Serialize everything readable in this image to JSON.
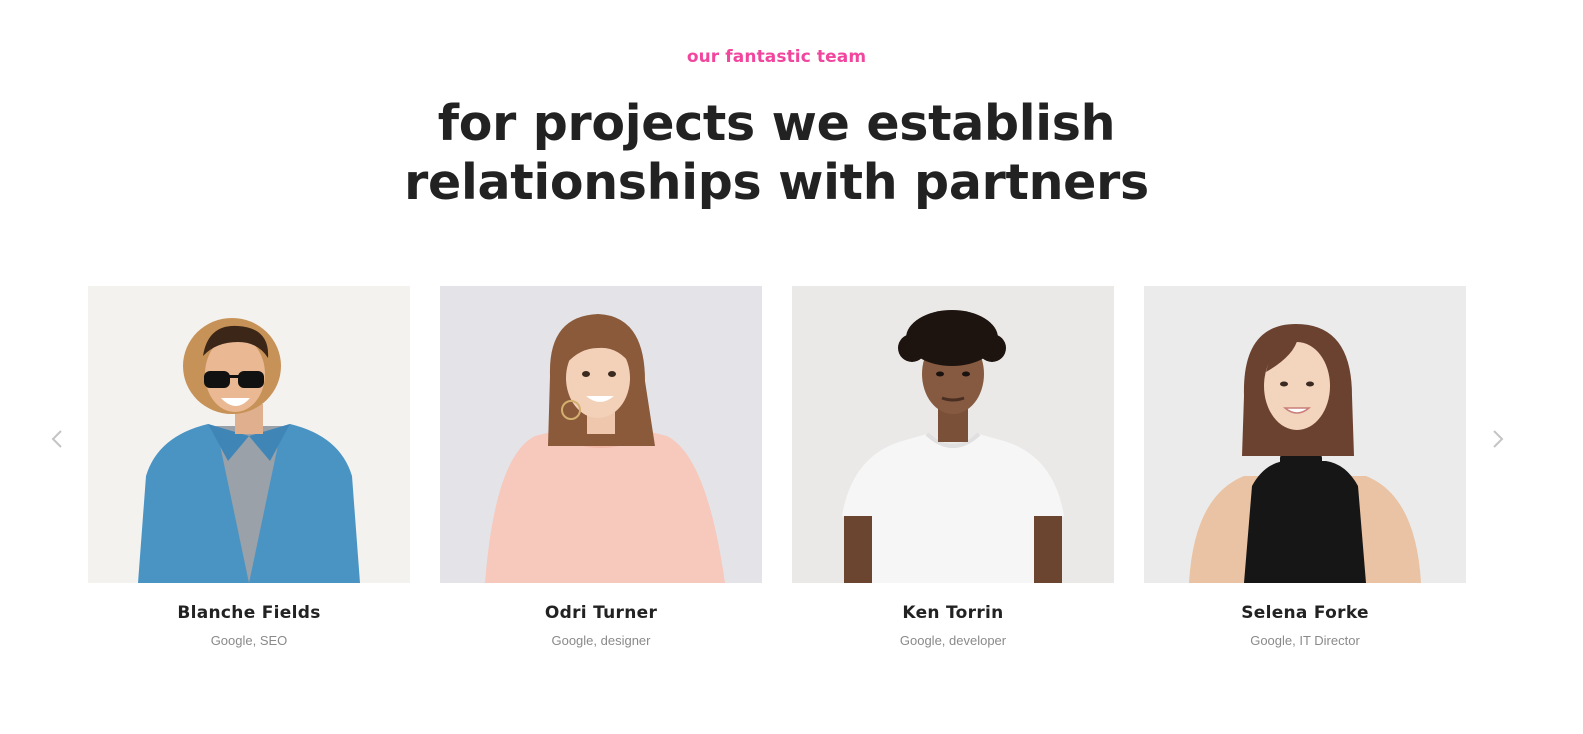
{
  "section": {
    "eyebrow": "our fantastic team",
    "headline_line1": "for projects we establish",
    "headline_line2": "relationships with partners",
    "accent_color": "#f2469e"
  },
  "carousel": {
    "prev_icon": "chevron-left-icon",
    "next_icon": "chevron-right-icon",
    "members": [
      {
        "name": "Blanche Fields",
        "role": "Google, SEO"
      },
      {
        "name": "Odri Turner",
        "role": "Google, designer"
      },
      {
        "name": "Ken Torrin",
        "role": "Google, developer"
      },
      {
        "name": "Selena Forke",
        "role": "Google, IT Director"
      }
    ]
  }
}
